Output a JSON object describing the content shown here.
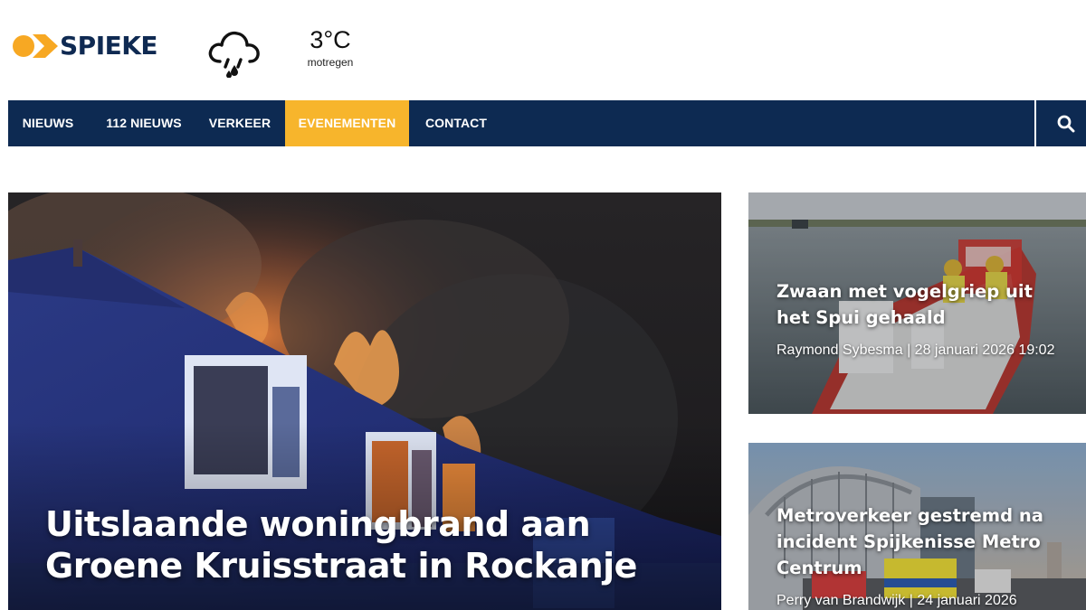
{
  "brand": {
    "logo_text": "SPIEKE",
    "accent_color": "#f7a823",
    "primary_color": "#0d2a52"
  },
  "weather": {
    "icon": "cloud-drizzle-icon",
    "temperature": "3°C",
    "condition": "motregen"
  },
  "nav": {
    "items": [
      {
        "label": "NIEUWS"
      },
      {
        "label": "112 NIEUWS"
      },
      {
        "label": "VERKEER"
      },
      {
        "label": "EVENEMENTEN",
        "active": true
      },
      {
        "label": "CONTACT"
      }
    ],
    "search_icon": "search-icon"
  },
  "featured": {
    "title": "Uitslaande woningbrand aan Groene Kruisstraat in Rockanje"
  },
  "articles": [
    {
      "title": "Zwaan met vogelgriep uit het Spui gehaald",
      "meta": "Raymond Sybesma | 28 januari 2026 19:02"
    },
    {
      "title": "Metroverkeer gestremd na incident Spijkenisse Metro Centrum",
      "meta": "Perry van Brandwijk | 24 januari 2026"
    }
  ]
}
